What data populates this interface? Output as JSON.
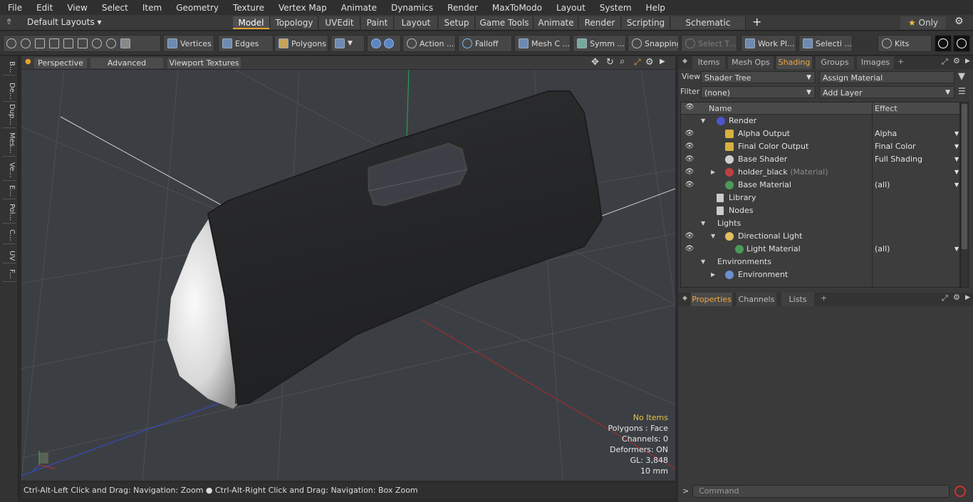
{
  "menu": [
    "File",
    "Edit",
    "View",
    "Select",
    "Item",
    "Geometry",
    "Texture",
    "Vertex Map",
    "Animate",
    "Dynamics",
    "Render",
    "MaxToModo",
    "Layout",
    "System",
    "Help"
  ],
  "layout_selector": "Default Layouts ▾",
  "mode_tabs": [
    "Model",
    "Topology",
    "UVEdit",
    "Paint",
    "Layout",
    "Setup",
    "Game Tools",
    "Animate",
    "Render",
    "Scripting",
    "Schematic Fusion"
  ],
  "active_mode": "Model",
  "only_label": "Only",
  "toolbar": {
    "vertices": "Vertices",
    "edges": "Edges",
    "polygons": "Polygons",
    "action": "Action ...",
    "falloff": "Falloff",
    "meshc": "Mesh C ...",
    "symm": "Symm ...",
    "snapping": "Snapping",
    "selectt": "Select T...",
    "workpl": "Work Pl...",
    "selecti": "Selecti ...",
    "kits": "Kits"
  },
  "left_tabs": [
    "B...",
    "De...",
    "Dup...",
    "Mes...",
    "Ve...",
    "E...",
    "Pol...",
    "C...",
    "UV",
    "F..."
  ],
  "viewport": {
    "perspective": "Perspective",
    "advanced": "Advanced",
    "textures": "Viewport Textures"
  },
  "hud": {
    "no_items": "No Items",
    "polygons": "Polygons : Face",
    "channels": "Channels: 0",
    "deformers": "Deformers: ON",
    "gl": "GL: 3,848",
    "unit": "10 mm"
  },
  "status_text": "Ctrl-Alt-Left Click and Drag: Navigation: Zoom ● Ctrl-Alt-Right Click and Drag: Navigation: Box Zoom",
  "right_tabs": [
    "Items",
    "Mesh Ops",
    "Shading",
    "Groups",
    "Images"
  ],
  "active_right_tab": "Shading",
  "view_label": "View",
  "view_value": "Shader Tree",
  "assign_material": "Assign Material",
  "filter_label": "Filter",
  "filter_value": "(none)",
  "add_layer": "Add Layer",
  "tree_header": {
    "name": "Name",
    "effect": "Effect"
  },
  "tree_rows": [
    {
      "name": "Render",
      "effect": "",
      "eye": false
    },
    {
      "name": "Alpha Output",
      "effect": "Alpha",
      "eye": true
    },
    {
      "name": "Final Color Output",
      "effect": "Final Color",
      "eye": true
    },
    {
      "name": "Base Shader",
      "effect": "Full Shading",
      "eye": true
    },
    {
      "name": "holder_black",
      "suffix": "(Material)",
      "effect": "",
      "eye": true
    },
    {
      "name": "Base Material",
      "effect": "(all)",
      "eye": true
    },
    {
      "name": "Library",
      "effect": "",
      "eye": false
    },
    {
      "name": "Nodes",
      "effect": "",
      "eye": false
    },
    {
      "name": "Lights",
      "effect": "",
      "eye": false
    },
    {
      "name": "Directional Light",
      "effect": "",
      "eye": true
    },
    {
      "name": "Light Material",
      "effect": "(all)",
      "eye": true
    },
    {
      "name": "Environments",
      "effect": "",
      "eye": false
    },
    {
      "name": "Environment",
      "effect": "",
      "eye": false
    }
  ],
  "bottom_tabs": [
    "Properties",
    "Channels",
    "Lists"
  ],
  "active_bottom_tab": "Properties",
  "command_placeholder": "Command",
  "colors": {
    "accent": "#e3a32a",
    "panel": "#3a3a3a",
    "viewport": "#3b3f44"
  }
}
